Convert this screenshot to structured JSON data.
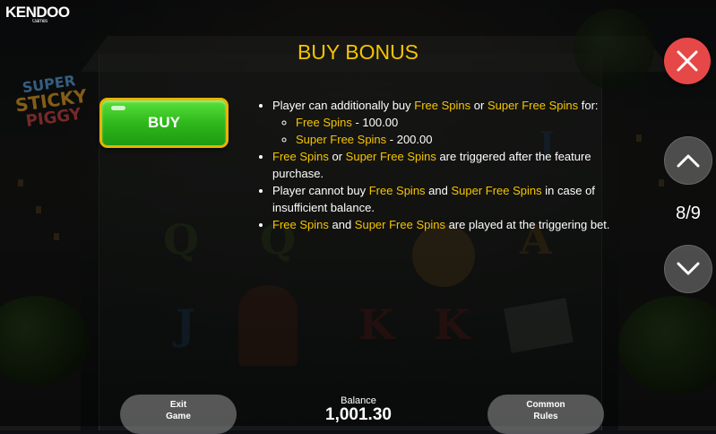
{
  "header": {
    "brand": "KENDOO",
    "brand_sub": "Games",
    "game_logo_lines": [
      "SUPER",
      "STICKY",
      "PIGGY"
    ]
  },
  "panel": {
    "title": "BUY BONUS",
    "buy_button_label": "BUY",
    "rules": {
      "item1_pre": "Player can additionally buy ",
      "free_spins": "Free Spins",
      "or": " or ",
      "super_free_spins": "Super Free Spins",
      "item1_post": " for:",
      "sub1_value": " - 100.00",
      "sub2_value": " - 200.00",
      "item2_post": " are triggered after the feature purchase.",
      "item3_pre": "Player cannot buy ",
      "and": " and ",
      "item3_post": " in case of insufficient balance.",
      "item4_post": " are played at the triggering bet."
    }
  },
  "navigation": {
    "page_indicator": "8/9",
    "close_icon": "close-icon",
    "up_icon": "chevron-up-icon",
    "down_icon": "chevron-down-icon"
  },
  "footer": {
    "exit_line1": "Exit",
    "exit_line2": "Game",
    "balance_label": "Balance",
    "balance_value": "1,001.30",
    "rules_line1": "Common",
    "rules_line2": "Rules"
  },
  "colors": {
    "highlight": "#f5c400",
    "buy_green": "#2fb81c",
    "buy_border": "#e8b400",
    "close_red": "#e64848"
  }
}
